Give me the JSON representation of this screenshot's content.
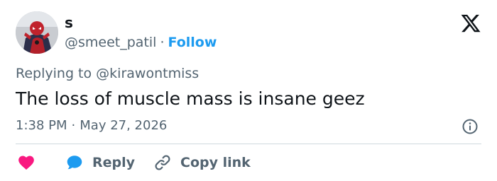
{
  "author": {
    "display_name": "s",
    "handle": "@smeet_patil",
    "separator": "·",
    "follow_label": "Follow"
  },
  "reply_context": {
    "prefix": "Replying to",
    "mention": "@kirawontmiss"
  },
  "tweet": {
    "text": "The loss of muscle mass is insane geez",
    "time": "1:38 PM",
    "separator": "·",
    "date": "May 27, 2026"
  },
  "actions": {
    "reply_label": "Reply",
    "copy_link_label": "Copy link"
  },
  "icons": {
    "logo": "x-logo-icon",
    "info": "info-icon",
    "like": "heart-icon",
    "reply": "speech-bubble-icon",
    "copy": "link-icon"
  },
  "colors": {
    "accent": "#1d9bf0",
    "like": "#f91880",
    "secondary_text": "#536471",
    "primary_text": "#0f1419",
    "divider": "#cfd9de"
  }
}
